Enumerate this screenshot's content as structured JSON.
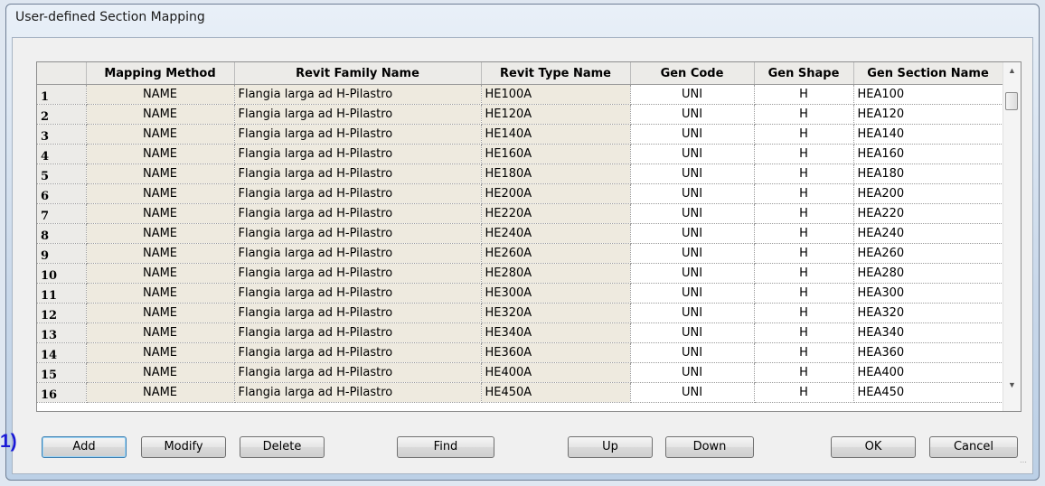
{
  "window": {
    "title": "User-defined Section Mapping"
  },
  "annotation": {
    "marker": "1)"
  },
  "table": {
    "columns": [
      "",
      "Mapping Method",
      "Revit Family Name",
      "Revit Type Name",
      "Gen Code",
      "Gen Shape",
      "Gen Section Name"
    ],
    "rows": [
      {
        "num": "1",
        "method": "NAME",
        "family": "Flangia larga ad H-Pilastro",
        "type": "HE100A",
        "code": "UNI",
        "shape": "H",
        "section": "HEA100"
      },
      {
        "num": "2",
        "method": "NAME",
        "family": "Flangia larga ad H-Pilastro",
        "type": "HE120A",
        "code": "UNI",
        "shape": "H",
        "section": "HEA120"
      },
      {
        "num": "3",
        "method": "NAME",
        "family": "Flangia larga ad H-Pilastro",
        "type": "HE140A",
        "code": "UNI",
        "shape": "H",
        "section": "HEA140"
      },
      {
        "num": "4",
        "method": "NAME",
        "family": "Flangia larga ad H-Pilastro",
        "type": "HE160A",
        "code": "UNI",
        "shape": "H",
        "section": "HEA160"
      },
      {
        "num": "5",
        "method": "NAME",
        "family": "Flangia larga ad H-Pilastro",
        "type": "HE180A",
        "code": "UNI",
        "shape": "H",
        "section": "HEA180"
      },
      {
        "num": "6",
        "method": "NAME",
        "family": "Flangia larga ad H-Pilastro",
        "type": "HE200A",
        "code": "UNI",
        "shape": "H",
        "section": "HEA200"
      },
      {
        "num": "7",
        "method": "NAME",
        "family": "Flangia larga ad H-Pilastro",
        "type": "HE220A",
        "code": "UNI",
        "shape": "H",
        "section": "HEA220"
      },
      {
        "num": "8",
        "method": "NAME",
        "family": "Flangia larga ad H-Pilastro",
        "type": "HE240A",
        "code": "UNI",
        "shape": "H",
        "section": "HEA240"
      },
      {
        "num": "9",
        "method": "NAME",
        "family": "Flangia larga ad H-Pilastro",
        "type": "HE260A",
        "code": "UNI",
        "shape": "H",
        "section": "HEA260"
      },
      {
        "num": "10",
        "method": "NAME",
        "family": "Flangia larga ad H-Pilastro",
        "type": "HE280A",
        "code": "UNI",
        "shape": "H",
        "section": "HEA280"
      },
      {
        "num": "11",
        "method": "NAME",
        "family": "Flangia larga ad H-Pilastro",
        "type": "HE300A",
        "code": "UNI",
        "shape": "H",
        "section": "HEA300"
      },
      {
        "num": "12",
        "method": "NAME",
        "family": "Flangia larga ad H-Pilastro",
        "type": "HE320A",
        "code": "UNI",
        "shape": "H",
        "section": "HEA320"
      },
      {
        "num": "13",
        "method": "NAME",
        "family": "Flangia larga ad H-Pilastro",
        "type": "HE340A",
        "code": "UNI",
        "shape": "H",
        "section": "HEA340"
      },
      {
        "num": "14",
        "method": "NAME",
        "family": "Flangia larga ad H-Pilastro",
        "type": "HE360A",
        "code": "UNI",
        "shape": "H",
        "section": "HEA360"
      },
      {
        "num": "15",
        "method": "NAME",
        "family": "Flangia larga ad H-Pilastro",
        "type": "HE400A",
        "code": "UNI",
        "shape": "H",
        "section": "HEA400"
      },
      {
        "num": "16",
        "method": "NAME",
        "family": "Flangia larga ad H-Pilastro",
        "type": "HE450A",
        "code": "UNI",
        "shape": "H",
        "section": "HEA450"
      }
    ]
  },
  "scrollbar": {
    "up_icon": "scroll-up-arrow-icon",
    "down_icon": "scroll-down-arrow-icon"
  },
  "buttons": {
    "add": "Add",
    "modify": "Modify",
    "delete": "Delete",
    "find": "Find",
    "up": "Up",
    "down": "Down",
    "ok": "OK",
    "cancel": "Cancel"
  },
  "colors": {
    "readonly_cell": "#eeeadf",
    "header": "#ecebe8",
    "marker": "#1a1ad6"
  }
}
